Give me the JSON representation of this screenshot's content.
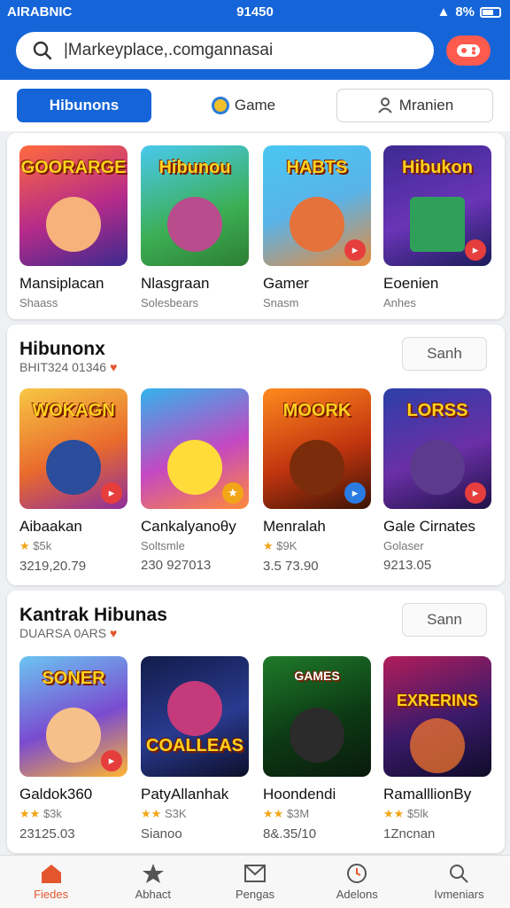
{
  "status": {
    "carrier": "AIRABNIC",
    "time": "91450",
    "battery": "8%"
  },
  "search": {
    "text": "|Markeyplace,.comgannasai"
  },
  "tabs": [
    {
      "label": "Hibunons"
    },
    {
      "label": "Game"
    },
    {
      "label": "Mranien"
    }
  ],
  "section1": {
    "items": [
      {
        "title": "GOORARGE",
        "name": "Mansiplacan",
        "meta": "Shaass"
      },
      {
        "title": "Hibunou",
        "name": "Nlasgraan",
        "meta": "Solesbears"
      },
      {
        "title": "HABTS",
        "name": "Gamer",
        "meta": "Snasm"
      },
      {
        "title": "Hibukon",
        "name": "Eoenien",
        "meta": "Anhes"
      }
    ]
  },
  "section2": {
    "title": "Hibunonx",
    "sub": "BHIT324 01346",
    "see": "Sanh",
    "items": [
      {
        "title": "WOKAGN",
        "name": "Aibaakan",
        "meta": "$5k",
        "price": "3219,20.79"
      },
      {
        "title": "",
        "name": "Cankalyanoθy",
        "meta": "Soltsmle",
        "price": "230 927013"
      },
      {
        "title": "MOORK",
        "name": "Menralah",
        "meta": "$9K",
        "price": "3.5 73.90"
      },
      {
        "title": "LORSS",
        "name": "Gale Cirnates",
        "meta": "Golaser",
        "price": "9213.05"
      }
    ]
  },
  "section3": {
    "title": "Kantrak Hibunas",
    "sub": "DUARSA 0ARS",
    "see": "Sann",
    "items": [
      {
        "title": "SONER",
        "name": "Galdok360",
        "meta": "$3k",
        "price": "23125.03"
      },
      {
        "title": "COALLEAS",
        "name": "PatyAllanhak",
        "meta": "S3K",
        "price": "Sianoo"
      },
      {
        "title": "GAMES",
        "name": "Hoondendi",
        "meta": "$3M",
        "price": "8&.35/10"
      },
      {
        "title": "EXRERINS",
        "name": "RamalllionBy",
        "meta": "$5lk",
        "price": "1Zncnan"
      }
    ]
  },
  "nav": [
    {
      "label": "Fiedes",
      "icon": "home-icon"
    },
    {
      "label": "Abhact",
      "icon": "star-icon"
    },
    {
      "label": "Pengas",
      "icon": "mail-icon"
    },
    {
      "label": "Adelons",
      "icon": "clock-icon"
    },
    {
      "label": "Ivmeniars",
      "icon": "search-icon"
    }
  ],
  "colors": {
    "primary": "#1565d8",
    "accent": "#e4572e"
  }
}
